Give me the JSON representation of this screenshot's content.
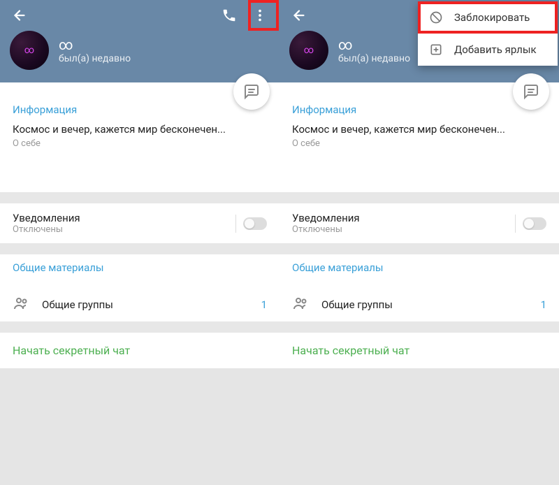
{
  "left": {
    "header": {
      "name": "∞",
      "status": "был(а) недавно"
    },
    "info": {
      "title": "Информация",
      "bio": "Космос и вечер, кажется мир бесконечен...",
      "bio_label": "О себе"
    },
    "notifications": {
      "title": "Уведомления",
      "status": "Отключены"
    },
    "shared": {
      "title": "Общие материалы",
      "groups_label": "Общие группы",
      "groups_count": "1"
    },
    "secret_chat": "Начать секретный чат"
  },
  "right": {
    "header": {
      "name": "∞",
      "status": "был(а) недавно"
    },
    "dropdown": {
      "block": "Заблокировать",
      "add_shortcut": "Добавить ярлык"
    },
    "info": {
      "title": "Информация",
      "bio": "Космос и вечер, кажется мир бесконечен...",
      "bio_label": "О себе"
    },
    "notifications": {
      "title": "Уведомления",
      "status": "Отключены"
    },
    "shared": {
      "title": "Общие материалы",
      "groups_label": "Общие группы",
      "groups_count": "1"
    },
    "secret_chat": "Начать секретный чат"
  }
}
